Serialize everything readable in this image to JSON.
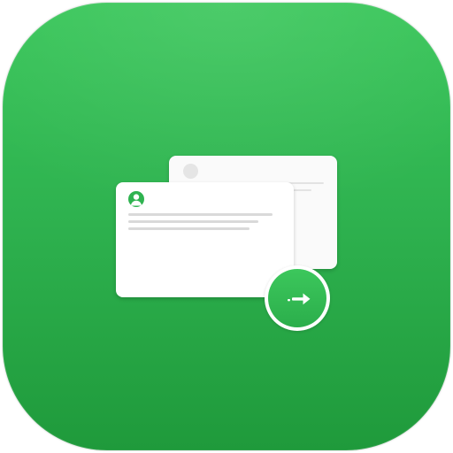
{
  "app_icon": {
    "semantic": "forward-message-app-icon",
    "colors": {
      "tile_top": "#38c659",
      "tile_mid": "#2fb350",
      "tile_bottom": "#1f9a3b",
      "card": "#ffffff",
      "line": "#d9d9d9",
      "accent": "#2fb350"
    },
    "icons": {
      "back_avatar": "avatar-placeholder-icon",
      "front_avatar": "user-avatar-icon",
      "action": "forward-arrow-icon"
    }
  }
}
